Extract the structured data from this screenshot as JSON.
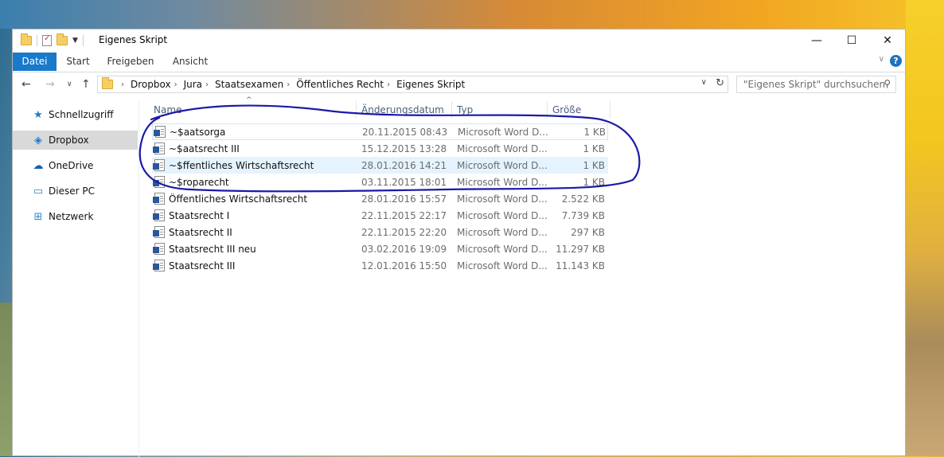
{
  "window": {
    "title": "Eigenes Skript"
  },
  "controls": {
    "minimize": "—",
    "maximize": "☐",
    "close": "✕"
  },
  "ribbon": {
    "tabs": [
      "Datei",
      "Start",
      "Freigeben",
      "Ansicht"
    ],
    "help": "?"
  },
  "address": {
    "crumbs": [
      "Dropbox",
      "Jura",
      "Staatsexamen",
      "Öffentliches Recht",
      "Eigenes Skript"
    ],
    "search_placeholder": "\"Eigenes Skript\" durchsuchen"
  },
  "navpane": {
    "items": [
      {
        "label": "Schnellzugriff",
        "icon": "star-icon"
      },
      {
        "label": "Dropbox",
        "icon": "dropbox-icon",
        "selected": true
      },
      {
        "label": "OneDrive",
        "icon": "cloud-icon"
      },
      {
        "label": "Dieser PC",
        "icon": "monitor-icon"
      },
      {
        "label": "Netzwerk",
        "icon": "network-icon"
      }
    ]
  },
  "columns": {
    "name": "Name",
    "date": "Änderungsdatum",
    "type": "Typ",
    "size": "Größe"
  },
  "files": [
    {
      "name": "~$aatsorga",
      "date": "20.11.2015 08:43",
      "type": "Microsoft Word D...",
      "size": "1 KB"
    },
    {
      "name": "~$aatsrecht III",
      "date": "15.12.2015 13:28",
      "type": "Microsoft Word D...",
      "size": "1 KB"
    },
    {
      "name": "~$ffentliches Wirtschaftsrecht",
      "date": "28.01.2016 14:21",
      "type": "Microsoft Word D...",
      "size": "1 KB"
    },
    {
      "name": "~$roparecht",
      "date": "03.11.2015 18:01",
      "type": "Microsoft Word D...",
      "size": "1 KB"
    },
    {
      "name": "Öffentliches Wirtschaftsrecht",
      "date": "28.01.2016 15:57",
      "type": "Microsoft Word D...",
      "size": "2.522 KB"
    },
    {
      "name": "Staatsrecht I",
      "date": "22.11.2015 22:17",
      "type": "Microsoft Word D...",
      "size": "7.739 KB"
    },
    {
      "name": "Staatsrecht II",
      "date": "22.11.2015 22:20",
      "type": "Microsoft Word D...",
      "size": "297 KB"
    },
    {
      "name": "Staatsrecht III neu",
      "date": "03.02.2016 19:09",
      "type": "Microsoft Word D...",
      "size": "11.297 KB"
    },
    {
      "name": "Staatsrecht III",
      "date": "12.01.2016 15:50",
      "type": "Microsoft Word D...",
      "size": "11.143 KB"
    }
  ],
  "colors": {
    "accent": "#1979ca",
    "annotation": "#1a1aa8",
    "hover_row": "#e5f3ff"
  }
}
